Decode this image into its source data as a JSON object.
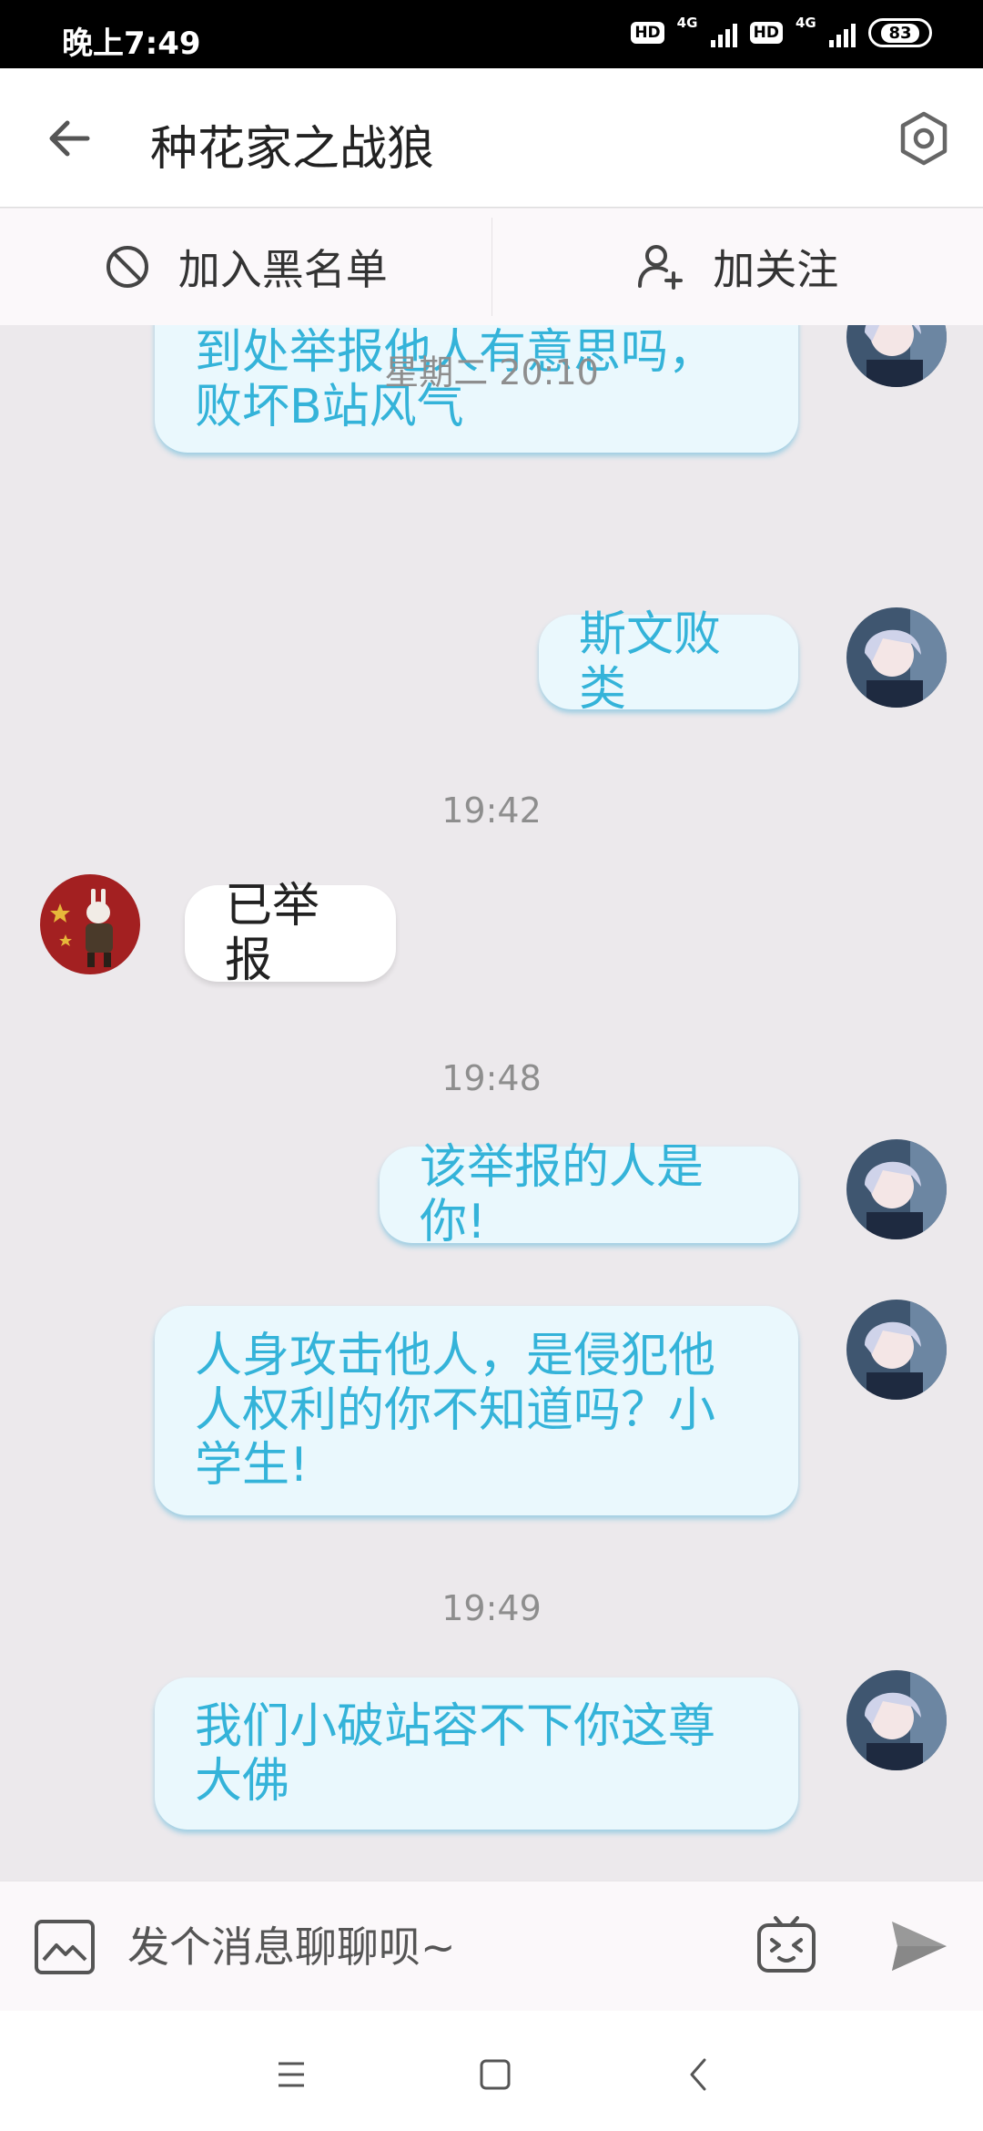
{
  "status_bar": {
    "time": "晚上7:49",
    "hd_1": "HD",
    "net_1": "4G",
    "hd_2": "HD",
    "net_2": "4G",
    "battery": "83"
  },
  "header": {
    "title": "种花家之战狼",
    "back_icon": "arrow-left-icon",
    "settings_icon": "hexagon-settings-icon"
  },
  "actions": {
    "block": {
      "label": "加入黑名单",
      "icon": "block-icon"
    },
    "follow": {
      "label": "加关注",
      "icon": "user-plus-icon"
    }
  },
  "messages": {
    "m1": "到处举报他人有意思吗，败坏B站风气",
    "t1": "星期二 20:10",
    "m2": "斯文败类",
    "t2": "19:42",
    "m3": "已举报",
    "t3": "19:48",
    "m4": "该举报的人是你!",
    "m5": "人身攻击他人，是侵犯他人权利的你不知道吗？小学生!",
    "t4": "19:49",
    "m6": "我们小破站容不下你这尊大佛"
  },
  "input_bar": {
    "placeholder": "发个消息聊聊呗~",
    "image_icon": "image-icon",
    "emoji_icon": "emoji-tv-icon",
    "send_icon": "send-icon"
  },
  "colors": {
    "mine_bubble_bg": "#eaf8fd",
    "mine_text": "#34b3d9",
    "chat_bg": "#ece9ec",
    "time_text": "#8e8e8e"
  }
}
